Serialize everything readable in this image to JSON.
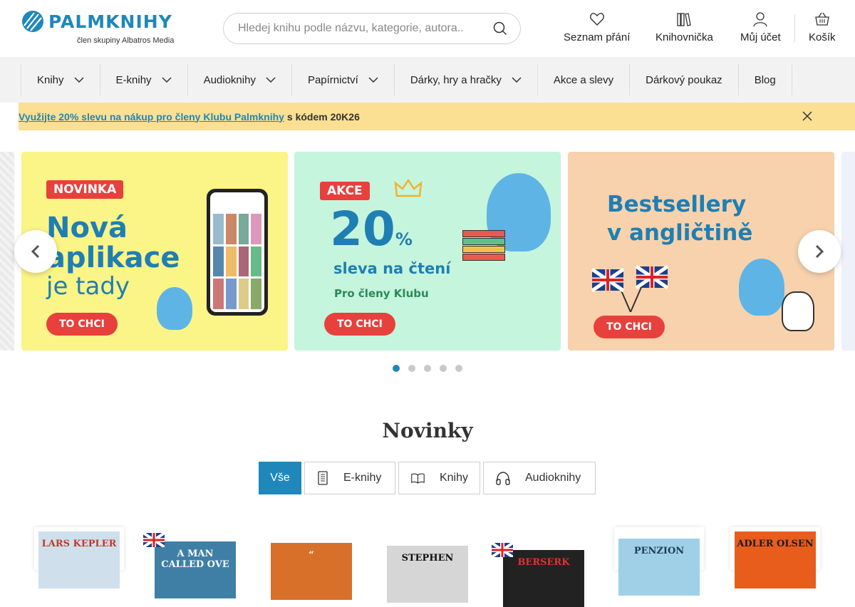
{
  "header": {
    "logo_text": "PALMKNIHY",
    "logo_sub": "člen skupiny Albatros Media",
    "search_placeholder": "Hledej knihu podle názvu, kategorie, autora..",
    "wishlist_label": "Seznam přání",
    "library_label": "Knihovnička",
    "account_label": "Můj účet",
    "cart_label": "Košík"
  },
  "nav": {
    "items": [
      {
        "label": "Knihy",
        "dropdown": true
      },
      {
        "label": "E-knihy",
        "dropdown": true
      },
      {
        "label": "Audioknihy",
        "dropdown": true
      },
      {
        "label": "Papírnictví",
        "dropdown": true
      },
      {
        "label": "Dárky, hry a hračky",
        "dropdown": true
      },
      {
        "label": "Akce a slevy",
        "dropdown": false
      },
      {
        "label": "Dárkový poukaz",
        "dropdown": false
      },
      {
        "label": "Blog",
        "dropdown": false
      }
    ]
  },
  "promo": {
    "link_text": "Využijte 20% slevu na nákup pro členy Klubu Palmknihy",
    "rest_text": "s kódem 20K26"
  },
  "carousel": {
    "slides": [
      {
        "badge": "NOVINKA",
        "line1": "Nová",
        "line2": "aplikace",
        "line3": "je tady",
        "cta": "TO CHCI",
        "bg": "#fbf487"
      },
      {
        "badge": "AKCE",
        "big": "20",
        "pct": "%",
        "sub": "sleva na čtení",
        "club": "Pro členy Klubu",
        "cta": "TO CHCI",
        "bg": "#c5f5dc"
      },
      {
        "line1": "Bestsellery",
        "line2": "v angličtině",
        "cta": "TO CHCI",
        "bg": "#f7d2ad"
      }
    ],
    "dot_count": 5,
    "active_dot": 0
  },
  "section": {
    "title": "Novinky",
    "filters": [
      {
        "label": "Vše",
        "icon": "none",
        "active": true
      },
      {
        "label": "E-knihy",
        "icon": "ereader-icon",
        "active": false
      },
      {
        "label": "Knihy",
        "icon": "book-icon",
        "active": false
      },
      {
        "label": "Audioknihy",
        "icon": "headphones-icon",
        "active": false
      }
    ]
  },
  "books": {
    "covers": [
      {
        "text": "LARS KEPLER",
        "bg": "#cfe0ec",
        "color": "#c0392b"
      },
      {
        "text": "A MAN CALLED OVE",
        "bg": "#3f7fa6",
        "color": "#fff",
        "flag": true
      },
      {
        "text": "“",
        "bg": "#d9702a",
        "color": "#fff"
      },
      {
        "text": "STEPHEN",
        "bg": "#d6d6d6",
        "color": "#111"
      },
      {
        "text": "BERSERK",
        "bg": "#222",
        "color": "#d33",
        "flag": true
      },
      {
        "text": "PENZION",
        "bg": "#9fd0e8",
        "color": "#1d3b5a"
      },
      {
        "text": "ADLER OLSEN",
        "bg": "#e85d1c",
        "color": "#1b1b1b"
      }
    ]
  },
  "colors": {
    "brand": "#1f87b9",
    "promo_bg": "#fbdf93",
    "nav_bg": "#f2f2f2",
    "cta": "#e8403c"
  }
}
